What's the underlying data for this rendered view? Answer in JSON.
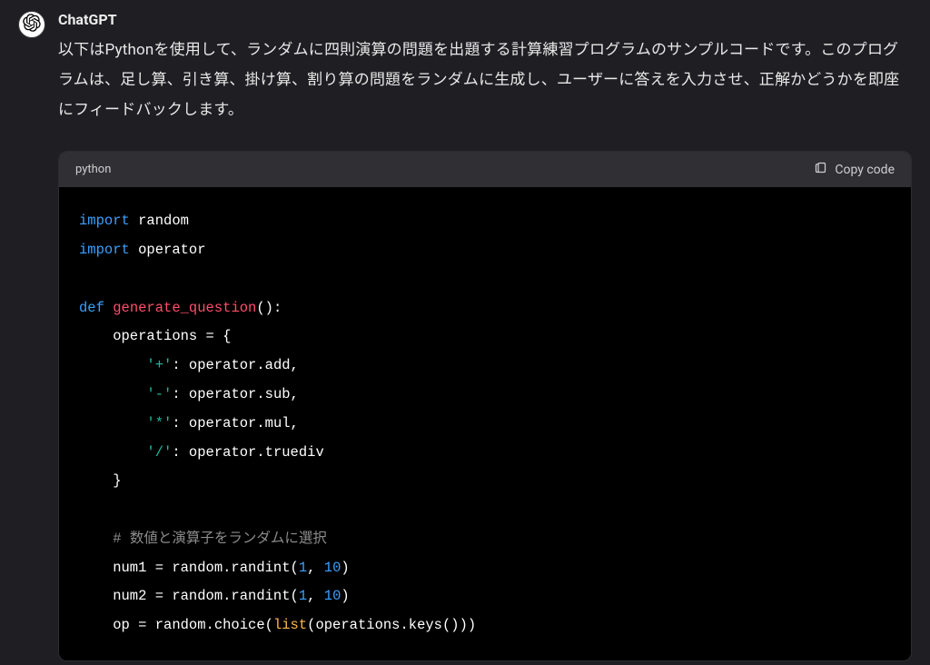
{
  "assistant": {
    "name": "ChatGPT",
    "icon": "openai-logo",
    "message": "以下はPythonを使用して、ランダムに四則演算の問題を出題する計算練習プログラムのサンプルコードです。このプログラムは、足し算、引き算、掛け算、割り算の問題をランダムに生成し、ユーザーに答えを入力させ、正解かどうかを即座にフィードバックします。"
  },
  "code": {
    "language": "python",
    "copy_label": "Copy code",
    "tokens": [
      [
        [
          "kw",
          "import"
        ],
        [
          "pln",
          " random"
        ]
      ],
      [
        [
          "kw",
          "import"
        ],
        [
          "pln",
          " operator"
        ]
      ],
      [],
      [
        [
          "def",
          "def"
        ],
        [
          "pln",
          " "
        ],
        [
          "fn",
          "generate_question"
        ],
        [
          "pln",
          "():"
        ]
      ],
      [
        [
          "pln",
          "    operations = {"
        ]
      ],
      [
        [
          "pln",
          "        "
        ],
        [
          "str",
          "'+'"
        ],
        [
          "pln",
          ": operator.add,"
        ]
      ],
      [
        [
          "pln",
          "        "
        ],
        [
          "str",
          "'-'"
        ],
        [
          "pln",
          ": operator.sub,"
        ]
      ],
      [
        [
          "pln",
          "        "
        ],
        [
          "str",
          "'*'"
        ],
        [
          "pln",
          ": operator.mul,"
        ]
      ],
      [
        [
          "pln",
          "        "
        ],
        [
          "str",
          "'/'"
        ],
        [
          "pln",
          ": operator.truediv"
        ]
      ],
      [
        [
          "pln",
          "    }"
        ]
      ],
      [],
      [
        [
          "pln",
          "    "
        ],
        [
          "cmt",
          "# 数値と演算子をランダムに選択"
        ]
      ],
      [
        [
          "pln",
          "    num1 = random.randint("
        ],
        [
          "num",
          "1"
        ],
        [
          "pln",
          ", "
        ],
        [
          "num",
          "10"
        ],
        [
          "pln",
          ")"
        ]
      ],
      [
        [
          "pln",
          "    num2 = random.randint("
        ],
        [
          "num",
          "1"
        ],
        [
          "pln",
          ", "
        ],
        [
          "num",
          "10"
        ],
        [
          "pln",
          ")"
        ]
      ],
      [
        [
          "pln",
          "    op = random.choice("
        ],
        [
          "bi",
          "list"
        ],
        [
          "pln",
          "(operations.keys()))"
        ]
      ]
    ]
  }
}
